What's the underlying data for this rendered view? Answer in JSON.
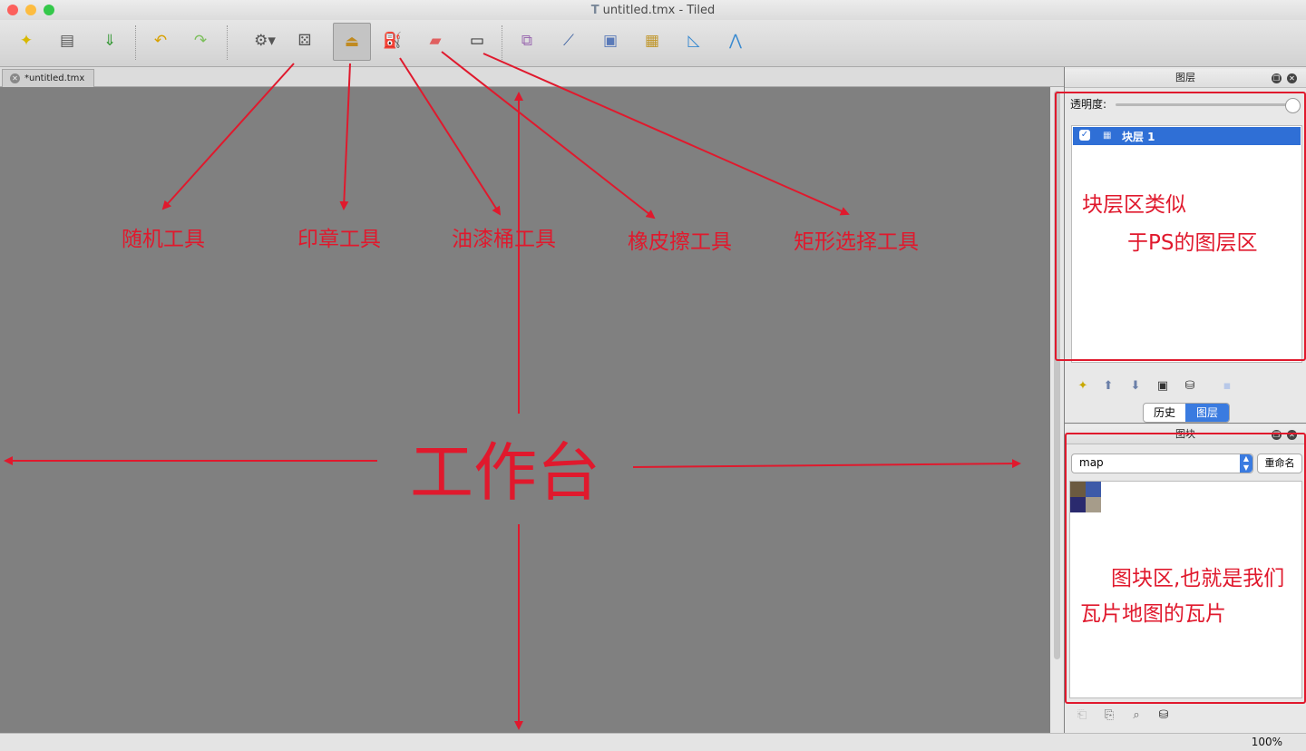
{
  "window": {
    "title": "untitled.tmx - Tiled"
  },
  "toolbar": {
    "buttons": [
      {
        "icon": "new-map-icon",
        "glyph": "✦"
      },
      {
        "icon": "open-icon",
        "glyph": "▤"
      },
      {
        "icon": "save-icon",
        "glyph": "⇓"
      },
      {
        "icon": "undo-icon",
        "glyph": "↶"
      },
      {
        "icon": "redo-icon",
        "glyph": "↷"
      },
      {
        "icon": "commands-icon",
        "glyph": "⚙▾"
      },
      {
        "icon": "random-mode-icon",
        "glyph": "⚄"
      },
      {
        "icon": "stamp-brush-icon",
        "glyph": "⏏"
      },
      {
        "icon": "bucket-fill-icon",
        "glyph": "⛽"
      },
      {
        "icon": "eraser-icon",
        "glyph": "▰"
      },
      {
        "icon": "rectangular-select-icon",
        "glyph": "▭"
      },
      {
        "icon": "magic-wand-icon",
        "glyph": "⧉"
      },
      {
        "icon": "edit-polygons-icon",
        "glyph": "⟋"
      },
      {
        "icon": "insert-tile-icon",
        "glyph": "▣"
      },
      {
        "icon": "insert-image-icon",
        "glyph": "▦"
      },
      {
        "icon": "insert-polygon-icon",
        "glyph": "◺"
      },
      {
        "icon": "insert-polyline-icon",
        "glyph": "⋀"
      }
    ]
  },
  "tab": {
    "label": "*untitled.tmx"
  },
  "layers_panel": {
    "title": "图层",
    "opacity_label": "透明度:",
    "opacity": 1.0,
    "layers": [
      {
        "name": "块层 1",
        "visible": true,
        "selected": true
      }
    ]
  },
  "bottom_tabs": {
    "history": "历史",
    "layers": "图层",
    "active": "图层"
  },
  "tilesets_panel": {
    "title": "图块",
    "selected_tileset": "map",
    "rename_label": "重命名"
  },
  "status": {
    "zoom": "100%"
  },
  "annotations": {
    "random": "随机工具",
    "stamp": "印章工具",
    "bucket": "油漆桶工具",
    "eraser": "橡皮擦工具",
    "rect_select": "矩形选择工具",
    "workbench": "工作台",
    "layers_line1": "块层区类似",
    "layers_line2": "于PS的图层区",
    "tiles_line1": "图块区,也就是我们",
    "tiles_line2": "瓦片地图的瓦片"
  },
  "colors": {
    "annotation": "#e0192d",
    "selection": "#2f6fd6",
    "canvas": "#808080"
  }
}
